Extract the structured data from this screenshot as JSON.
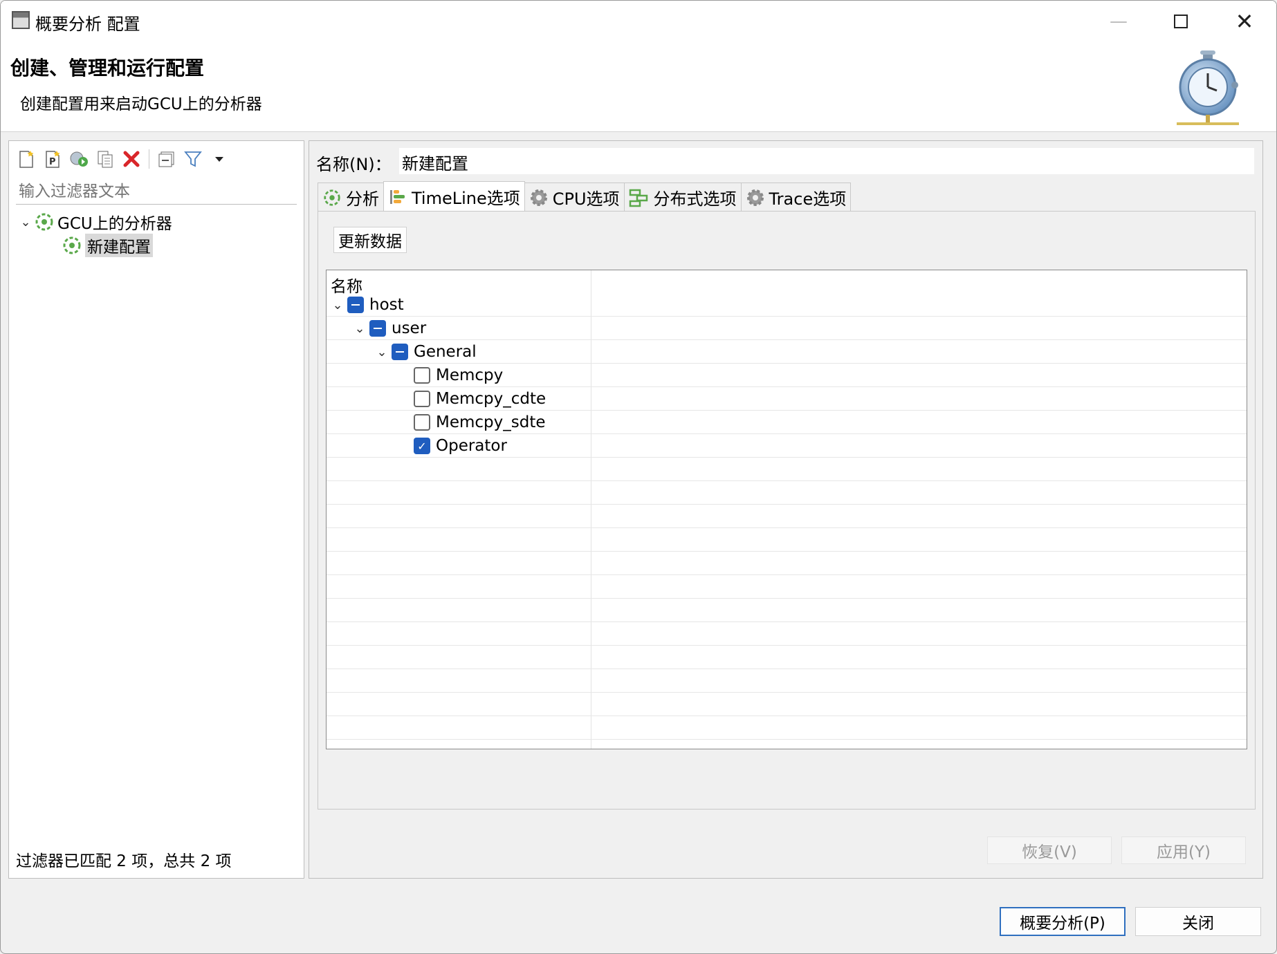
{
  "window": {
    "title": "概要分析 配置",
    "min_glyph": "—",
    "close_glyph": "✕"
  },
  "header": {
    "title": "创建、管理和运行配置",
    "description": "创建配置用来启动GCU上的分析器"
  },
  "left": {
    "toolbar_icons": [
      "new-config-icon",
      "new-prototype-icon",
      "export-icon",
      "duplicate-icon",
      "delete-icon",
      "collapse-all-icon",
      "filter-icon",
      "view-menu-icon"
    ],
    "filter_placeholder": "输入过滤器文本",
    "tree": {
      "root_label": "GCU上的分析器",
      "child_label": "新建配置"
    },
    "status": "过滤器已匹配 2 项，总共 2 项"
  },
  "right": {
    "name_label": "名称(N)：",
    "name_value": "新建配置",
    "tabs": [
      {
        "label": "分析",
        "icon": "analysis-icon"
      },
      {
        "label": "TimeLine选项",
        "icon": "timeline-icon"
      },
      {
        "label": "CPU选项",
        "icon": "gear-icon"
      },
      {
        "label": "分布式选项",
        "icon": "distributed-icon"
      },
      {
        "label": "Trace选项",
        "icon": "gear-icon"
      }
    ],
    "active_tab": "TimeLine选项",
    "refresh_label": "更新数据",
    "table": {
      "column_header": "名称",
      "rows": [
        {
          "label": "host",
          "state": "mixed",
          "expanded": true
        },
        {
          "label": "user",
          "state": "mixed",
          "expanded": true
        },
        {
          "label": "General",
          "state": "mixed",
          "expanded": true
        },
        {
          "label": "Memcpy",
          "state": "unchecked"
        },
        {
          "label": "Memcpy_cdte",
          "state": "unchecked"
        },
        {
          "label": "Memcpy_sdte",
          "state": "unchecked"
        },
        {
          "label": "Operator",
          "state": "checked"
        }
      ]
    },
    "revert_label": "恢复(V)",
    "apply_label": "应用(Y)"
  },
  "footer": {
    "profile_label": "概要分析(P)",
    "close_label": "关闭"
  },
  "colors": {
    "accent": "#1f5dbf",
    "icon_green": "#5aa84a",
    "delete_red": "#d9262a"
  }
}
